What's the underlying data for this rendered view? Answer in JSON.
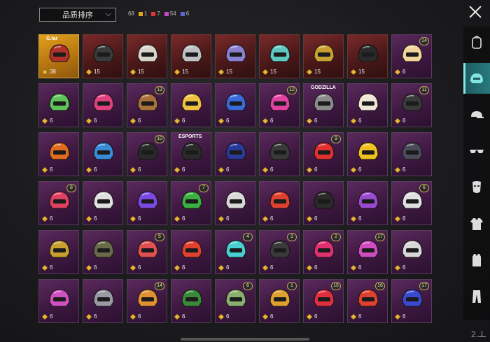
{
  "header": {
    "sort_label": "品质排序",
    "total_count": "68",
    "rarity_counts": [
      {
        "color": "#e8a21a",
        "count": "1"
      },
      {
        "color": "#e0343a",
        "count": "7"
      },
      {
        "color": "#c548c9",
        "count": "54"
      },
      {
        "color": "#5a68d8",
        "count": "6"
      }
    ],
    "close_icon": "close-icon"
  },
  "sidebar": {
    "items": [
      {
        "icon": "backpack-icon",
        "active": false
      },
      {
        "icon": "helmet-icon",
        "active": true
      },
      {
        "icon": "cap-icon",
        "active": false
      },
      {
        "icon": "glasses-icon",
        "active": false
      },
      {
        "icon": "face-mask-icon",
        "active": false
      },
      {
        "icon": "jacket-icon",
        "active": false
      },
      {
        "icon": "vest-icon",
        "active": false
      },
      {
        "icon": "pants-icon",
        "active": false
      }
    ]
  },
  "items": [
    {
      "rarity": "gold",
      "count": "38",
      "level": "",
      "tag": "G.tar",
      "color": "#b0302a"
    },
    {
      "rarity": "red",
      "count": "15",
      "level": "",
      "tag": "",
      "color": "#3a3a3a"
    },
    {
      "rarity": "red",
      "count": "15",
      "level": "",
      "tag": "",
      "color": "#d8d4cc"
    },
    {
      "rarity": "red",
      "count": "15",
      "level": "",
      "tag": "",
      "color": "#bfbfc4"
    },
    {
      "rarity": "red",
      "count": "15",
      "level": "",
      "tag": "",
      "color": "#8a7fd0"
    },
    {
      "rarity": "red",
      "count": "15",
      "level": "",
      "tag": "",
      "color": "#5ec8c0"
    },
    {
      "rarity": "red",
      "count": "15",
      "level": "",
      "tag": "",
      "color": "#c8a030"
    },
    {
      "rarity": "red",
      "count": "15",
      "level": "",
      "tag": "",
      "color": "#2a2a2a"
    },
    {
      "rarity": "purple",
      "count": "6",
      "level": "14",
      "tag": "",
      "color": "#f1d49a"
    },
    {
      "rarity": "purple",
      "count": "6",
      "level": "",
      "tag": "",
      "color": "#5fc25a"
    },
    {
      "rarity": "purple",
      "count": "6",
      "level": "",
      "tag": "",
      "color": "#e04080"
    },
    {
      "rarity": "purple",
      "count": "6",
      "level": "13",
      "tag": "",
      "color": "#a8703a"
    },
    {
      "rarity": "purple",
      "count": "6",
      "level": "",
      "tag": "",
      "color": "#f0c040"
    },
    {
      "rarity": "purple",
      "count": "6",
      "level": "",
      "tag": "",
      "color": "#3a6ad8"
    },
    {
      "rarity": "purple",
      "count": "6",
      "level": "12",
      "tag": "",
      "color": "#e040a0"
    },
    {
      "rarity": "purple",
      "count": "6",
      "level": "",
      "tag": "GODZILLA",
      "color": "#8a8a8a"
    },
    {
      "rarity": "purple",
      "count": "6",
      "level": "",
      "tag": "",
      "color": "#f0e6d8"
    },
    {
      "rarity": "purple",
      "count": "6",
      "level": "11",
      "tag": "",
      "color": "#3a3a3a"
    },
    {
      "rarity": "purple",
      "count": "6",
      "level": "",
      "tag": "",
      "color": "#e06a20"
    },
    {
      "rarity": "purple",
      "count": "6",
      "level": "",
      "tag": "",
      "color": "#3a8ad8"
    },
    {
      "rarity": "purple",
      "count": "6",
      "level": "10",
      "tag": "",
      "color": "#2a2a2a"
    },
    {
      "rarity": "purple",
      "count": "6",
      "level": "",
      "tag": "ESPORTS",
      "color": "#2a2a2a"
    },
    {
      "rarity": "purple",
      "count": "6",
      "level": "",
      "tag": "",
      "color": "#2a3a9a"
    },
    {
      "rarity": "purple",
      "count": "6",
      "level": "",
      "tag": "",
      "color": "#3a3a3a"
    },
    {
      "rarity": "purple",
      "count": "6",
      "level": "9",
      "tag": "",
      "color": "#e03030"
    },
    {
      "rarity": "purple",
      "count": "6",
      "level": "",
      "tag": "",
      "color": "#f0c020"
    },
    {
      "rarity": "purple",
      "count": "6",
      "level": "",
      "tag": "",
      "color": "#4a4a5a"
    },
    {
      "rarity": "purple",
      "count": "6",
      "level": "8",
      "tag": "",
      "color": "#e04060"
    },
    {
      "rarity": "purple",
      "count": "6",
      "level": "",
      "tag": "",
      "color": "#e0e0e0"
    },
    {
      "rarity": "purple",
      "count": "6",
      "level": "",
      "tag": "",
      "color": "#7a4ae0"
    },
    {
      "rarity": "purple",
      "count": "6",
      "level": "7",
      "tag": "",
      "color": "#3ab040"
    },
    {
      "rarity": "purple",
      "count": "6",
      "level": "",
      "tag": "",
      "color": "#d8d8d8"
    },
    {
      "rarity": "purple",
      "count": "6",
      "level": "",
      "tag": "",
      "color": "#e04030"
    },
    {
      "rarity": "purple",
      "count": "6",
      "level": "",
      "tag": "",
      "color": "#2a2a2a"
    },
    {
      "rarity": "purple",
      "count": "6",
      "level": "",
      "tag": "",
      "color": "#9a4ad0"
    },
    {
      "rarity": "purple",
      "count": "6",
      "level": "6",
      "tag": "",
      "color": "#e0e0e0"
    },
    {
      "rarity": "purple",
      "count": "6",
      "level": "",
      "tag": "",
      "color": "#c8a030"
    },
    {
      "rarity": "purple",
      "count": "6",
      "level": "",
      "tag": "",
      "color": "#6a6a4a"
    },
    {
      "rarity": "purple",
      "count": "6",
      "level": "5",
      "tag": "",
      "color": "#e05050"
    },
    {
      "rarity": "purple",
      "count": "6",
      "level": "",
      "tag": "",
      "color": "#e04030"
    },
    {
      "rarity": "purple",
      "count": "6",
      "level": "4",
      "tag": "",
      "color": "#4ad0d0"
    },
    {
      "rarity": "purple",
      "count": "6",
      "level": "3",
      "tag": "",
      "color": "#3a3a3a"
    },
    {
      "rarity": "purple",
      "count": "6",
      "level": "2",
      "tag": "",
      "color": "#e03070"
    },
    {
      "rarity": "purple",
      "count": "6",
      "level": "17",
      "tag": "",
      "color": "#d04ac0"
    },
    {
      "rarity": "purple",
      "count": "6",
      "level": "",
      "tag": "",
      "color": "#d8d8d8"
    },
    {
      "rarity": "purple",
      "count": "6",
      "level": "",
      "tag": "",
      "color": "#d050c0"
    },
    {
      "rarity": "purple",
      "count": "6",
      "level": "",
      "tag": "",
      "color": "#9a9aa4"
    },
    {
      "rarity": "purple",
      "count": "6",
      "level": "14",
      "tag": "",
      "color": "#e09030"
    },
    {
      "rarity": "purple",
      "count": "6",
      "level": "",
      "tag": "",
      "color": "#3a8a3a"
    },
    {
      "rarity": "purple",
      "count": "6",
      "level": "6",
      "tag": "",
      "color": "#8ab070"
    },
    {
      "rarity": "purple",
      "count": "6",
      "level": "1",
      "tag": "",
      "color": "#e0a030"
    },
    {
      "rarity": "purple",
      "count": "6",
      "level": "15",
      "tag": "",
      "color": "#e03040"
    },
    {
      "rarity": "purple",
      "count": "6",
      "level": "16",
      "tag": "",
      "color": "#e04030"
    },
    {
      "rarity": "purple",
      "count": "6",
      "level": "17",
      "tag": "",
      "color": "#3a4ad0"
    }
  ],
  "watermark": "2.ـلـ"
}
